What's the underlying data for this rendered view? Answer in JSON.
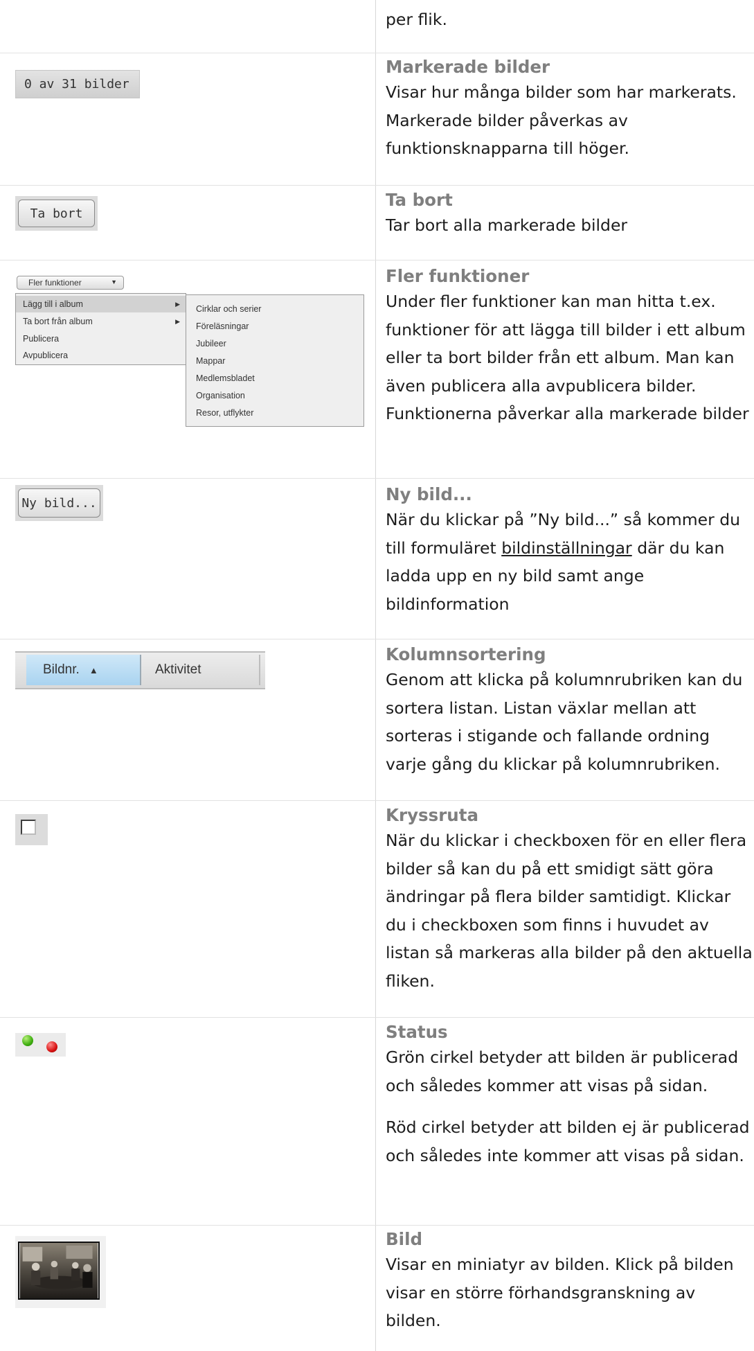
{
  "rows": [
    {
      "desc": "per flik."
    },
    {
      "ui_text": "0 av 31 bilder",
      "title": "Markerade bilder",
      "desc": "Visar hur många bilder som har markerats. Markerade bilder påverkas av funktionsknapparna till höger."
    },
    {
      "ui_text": "Ta bort",
      "title": "Ta bort",
      "desc": "Tar bort alla markerade bilder"
    },
    {
      "ui_text": "Fler funktioner",
      "title": "Fler funktioner",
      "menu": [
        "Lägg till i album",
        "Ta bort från album",
        "Publicera",
        "Avpublicera"
      ],
      "submenu": [
        "Cirklar och serier",
        "Föreläsningar",
        "Jubileer",
        "Mappar",
        "Medlemsbladet",
        "Organisation",
        "Resor, utflykter"
      ],
      "desc": "Under fler funktioner kan man hitta t.ex. funktioner för att lägga till bilder i ett album eller ta bort bilder från ett album.  Man kan även publicera alla avpublicera bilder. Funktionerna påverkar alla markerade bilder"
    },
    {
      "ui_text": "Ny bild...",
      "title": "Ny bild...",
      "desc_a": "När du klickar på ”Ny bild...” så kommer du till formuläret ",
      "link": "bildinställningar",
      "desc_b": " där du kan ladda upp en ny bild samt ange bildinformation"
    },
    {
      "col_sorted": "Bildnr.",
      "col2": "Aktivitet",
      "title": "Kolumnsortering",
      "desc": "Genom att klicka på kolumnrubriken kan du sortera listan. Listan växlar mellan att sorteras i stigande och fallande ordning varje gång du klickar på kolumnrubriken."
    },
    {
      "title": "Kryssruta",
      "desc": "När du klickar i checkboxen för en eller flera bilder så kan du på ett smidigt sätt göra ändringar på flera bilder samtidigt. Klickar du i checkboxen som finns i huvudet av listan så markeras alla bilder på den aktuella fliken."
    },
    {
      "title": "Status",
      "desc": "Grön cirkel betyder att bilden är publicerad och således kommer att visas på sidan.",
      "desc2": "Röd cirkel betyder att bilden ej är publicerad och således inte kommer att visas på sidan.",
      "colors": {
        "green": "#3fae10",
        "red": "#d81212"
      }
    },
    {
      "title": "Bild",
      "desc": "Visar en miniatyr av bilden. Klick på bilden visar en större förhandsgranskning av bilden."
    }
  ]
}
